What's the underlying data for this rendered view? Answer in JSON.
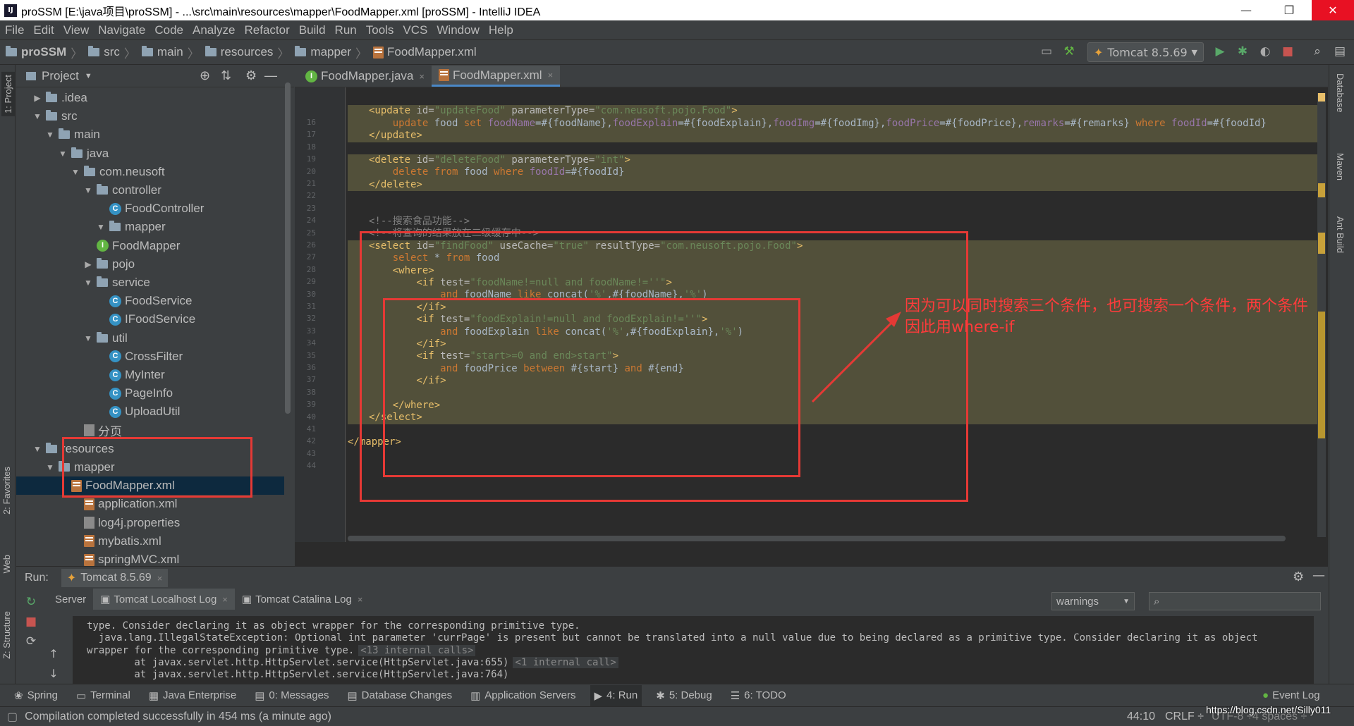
{
  "window": {
    "title": "proSSM [E:\\java项目\\proSSM] - ...\\src\\main\\resources\\mapper\\FoodMapper.xml [proSSM] - IntelliJ IDEA",
    "app_icon": "IJ",
    "minimize": "—",
    "restore": "❐",
    "close": "✕"
  },
  "menu": [
    "File",
    "Edit",
    "View",
    "Navigate",
    "Code",
    "Analyze",
    "Refactor",
    "Build",
    "Run",
    "Tools",
    "VCS",
    "Window",
    "Help"
  ],
  "breadcrumb": [
    "proSSM",
    "src",
    "main",
    "resources",
    "mapper",
    "FoodMapper.xml"
  ],
  "run_config": {
    "label": "Tomcat 8.5.69",
    "arrow": "▼"
  },
  "left_strip": {
    "project": "1: Project",
    "favorites": "2: Favorites",
    "web": "Web",
    "structure": "Z: Structure"
  },
  "right_strip": {
    "database": "Database",
    "maven": "Maven",
    "ant": "Ant Build"
  },
  "project_panel": {
    "title": "Project",
    "tree": [
      {
        "label": ".idea",
        "type": "folder",
        "arrow": "▶"
      },
      {
        "label": "src",
        "type": "folder",
        "arrow": "▼"
      },
      {
        "label": "main",
        "type": "folder",
        "arrow": "▼"
      },
      {
        "label": "java",
        "type": "folder",
        "arrow": "▼"
      },
      {
        "label": "com.neusoft",
        "type": "folder",
        "arrow": "▼"
      },
      {
        "label": "controller",
        "type": "folder",
        "arrow": "▼"
      },
      {
        "label": "FoodController",
        "type": "class"
      },
      {
        "label": "mapper",
        "type": "folder",
        "arrow": "▼"
      },
      {
        "label": "FoodMapper",
        "type": "iface"
      },
      {
        "label": "pojo",
        "type": "folder",
        "arrow": "▶"
      },
      {
        "label": "service",
        "type": "folder",
        "arrow": "▼"
      },
      {
        "label": "FoodService",
        "type": "class"
      },
      {
        "label": "IFoodService",
        "type": "class"
      },
      {
        "label": "util",
        "type": "folder",
        "arrow": "▼"
      },
      {
        "label": "CrossFilter",
        "type": "class"
      },
      {
        "label": "MyInter",
        "type": "class"
      },
      {
        "label": "PageInfo",
        "type": "class"
      },
      {
        "label": "UploadUtil",
        "type": "class"
      },
      {
        "label": "分页",
        "type": "file"
      },
      {
        "label": "resources",
        "type": "folder",
        "arrow": "▼"
      },
      {
        "label": "mapper",
        "type": "folder",
        "arrow": "▼"
      },
      {
        "label": "FoodMapper.xml",
        "type": "xml"
      },
      {
        "label": "application.xml",
        "type": "xml"
      },
      {
        "label": "log4j.properties",
        "type": "prop"
      },
      {
        "label": "mybatis.xml",
        "type": "xml"
      },
      {
        "label": "springMVC.xml",
        "type": "xml"
      }
    ]
  },
  "editor_tabs": [
    {
      "label": "FoodMapper.java",
      "close": "×"
    },
    {
      "label": "FoodMapper.xml",
      "close": "×"
    }
  ],
  "code_lines": [
    {
      "n": "16",
      "html": ""
    },
    {
      "n": "17",
      "html": "<span class='tag'>&lt;update </span><span class='attr'>id=</span><span class='str'>\"updateFood\"</span><span class='attr'> parameterType=</span><span class='str'>\"com.neusoft.pojo.Food\"</span><span class='tag'>&gt;</span>"
    },
    {
      "n": "18",
      "html": "    <span class='kw'>update</span> food <span class='kw'>set</span> <span class='fld'>foodName</span>=#{foodName},<span class='fld'>foodExplain</span>=#{foodExplain},<span class='fld'>foodImg</span>=#{foodImg},<span class='fld'>foodPrice</span>=#{foodPrice},<span class='fld'>remarks</span>=#{remarks} <span class='kw'>where</span> <span class='fld'>foodId</span>=#{foodId}"
    },
    {
      "n": "19",
      "html": "<span class='tag'>&lt;/update&gt;</span>"
    },
    {
      "n": "20",
      "html": ""
    },
    {
      "n": "21",
      "html": "<span class='tag'>&lt;delete </span><span class='attr'>id=</span><span class='str'>\"deleteFood\"</span><span class='attr'> parameterType=</span><span class='str'>\"int\"</span><span class='tag'>&gt;</span>"
    },
    {
      "n": "22",
      "html": "    <span class='kw'>delete from</span> food <span class='kw'>where</span> <span class='fld'>foodId</span>=#{foodId}"
    },
    {
      "n": "23",
      "html": "<span class='tag'>&lt;/delete&gt;</span>"
    },
    {
      "n": "24",
      "html": ""
    },
    {
      "n": "25",
      "html": ""
    },
    {
      "n": "26",
      "html": "<span class='cmt'>&lt;!--搜索食品功能--&gt;</span>"
    },
    {
      "n": "27",
      "html": "<span class='cmt'>&lt;!--将查询的结果放在二级缓存中--&gt;</span>"
    },
    {
      "n": "28",
      "html": "<span class='tag'>&lt;select </span><span class='attr'>id=</span><span class='str'>\"findFood\"</span><span class='attr'> useCache=</span><span class='str'>\"true\"</span><span class='attr'> resultType=</span><span class='str'>\"com.neusoft.pojo.Food\"</span><span class='tag'>&gt;</span>"
    },
    {
      "n": "29",
      "html": "    <span class='kw'>select</span> * <span class='kw'>from</span> food"
    },
    {
      "n": "30",
      "html": "    <span class='tag'>&lt;where&gt;</span>"
    },
    {
      "n": "31",
      "html": "        <span class='tag'>&lt;if </span><span class='attr'>test=</span><span class='str'>\"foodName!=null and foodName!=''\"</span><span class='tag'>&gt;</span>"
    },
    {
      "n": "32",
      "html": "            <span class='kw'>and</span> foodName <span class='kw'>like</span> concat(<span class='str'>'%'</span>,#{foodName},<span class='str'>'%'</span>)"
    },
    {
      "n": "33",
      "html": "        <span class='tag'>&lt;/if&gt;</span>"
    },
    {
      "n": "34",
      "html": "        <span class='tag'>&lt;if </span><span class='attr'>test=</span><span class='str'>\"foodExplain!=null and foodExplain!=''\"</span><span class='tag'>&gt;</span>"
    },
    {
      "n": "35",
      "html": "            <span class='kw'>and</span> foodExplain <span class='kw'>like</span> concat(<span class='str'>'%'</span>,#{foodExplain},<span class='str'>'%'</span>)"
    },
    {
      "n": "36",
      "html": "        <span class='tag'>&lt;/if&gt;</span>"
    },
    {
      "n": "37",
      "html": "        <span class='tag'>&lt;if </span><span class='attr'>test=</span><span class='str'>\"start&gt;=0 and end&gt;start\"</span><span class='tag'>&gt;</span>"
    },
    {
      "n": "38",
      "html": "            <span class='kw'>and</span> foodPrice <span class='kw'>between</span> #{start} <span class='kw'>and</span> #{end}"
    },
    {
      "n": "39",
      "html": "        <span class='tag'>&lt;/if&gt;</span>"
    },
    {
      "n": "40",
      "html": ""
    },
    {
      "n": "41",
      "html": "    <span class='tag'>&lt;/where&gt;</span>"
    },
    {
      "n": "42",
      "html": "<span class='tag'>&lt;/select&gt;</span>"
    },
    {
      "n": "43",
      "html": ""
    },
    {
      "n": "44",
      "html": "<span class='tag'>&lt;/mapper&gt;</span>"
    }
  ],
  "annotation": {
    "line1": "因为可以同时搜索三个条件，也可搜索一个条件，两个条件",
    "line2": "因此用where-if"
  },
  "run_panel": {
    "label": "Run:",
    "config": "Tomcat 8.5.69",
    "tabs": [
      "Server",
      "Tomcat Localhost Log",
      "Tomcat Catalina Log"
    ],
    "filter": "warnings",
    "search_placeholder": "",
    "console": [
      "type. Consider declaring it as object wrapper for the corresponding primitive type.",
      "  java.lang.IllegalStateException: Optional int parameter 'currPage' is present but cannot be translated into a null value due to being declared as a primitive type. Consider declaring it as object",
      "wrapper for the corresponding primitive type.",
      "        at javax.servlet.http.HttpServlet.service(HttpServlet.java:655)",
      "        at javax.servlet.http.HttpServlet.service(HttpServlet.java:764)"
    ],
    "inline_1": "<13 internal calls>",
    "inline_2": "<1 internal call>"
  },
  "bottom_tabs": [
    "Spring",
    "Terminal",
    "Java Enterprise",
    "0: Messages",
    "Database Changes",
    "Application Servers",
    "4: Run",
    "5: Debug",
    "6: TODO"
  ],
  "event_log": "Event Log",
  "status": {
    "message": "Compilation completed successfully in 454 ms (a minute ago)",
    "position": "44:10",
    "line_sep": "CRLF ÷",
    "encoding": "UTF-8 ÷",
    "indent": "4 spaces ÷",
    "watermark": "https://blog.csdn.net/Silly011"
  },
  "colors": {
    "accent": "#4a88c7",
    "red_box": "#e53935",
    "annotation": "#ff3b3b",
    "highlight": "#52503a"
  }
}
